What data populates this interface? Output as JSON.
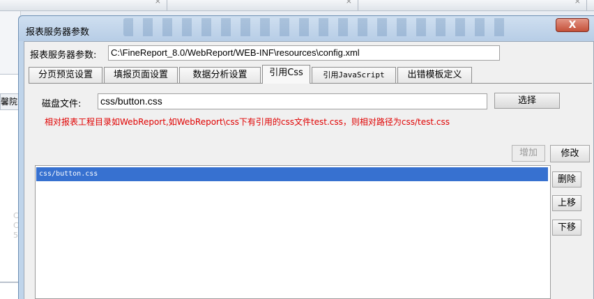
{
  "dialog": {
    "title": "报表服务器参数",
    "close_label": "X",
    "path_label": "报表服务器参数:",
    "path_value": "C:\\FineReport_8.0/WebReport/WEB-INF\\resources\\config.xml"
  },
  "tabs": [
    "分页预览设置",
    "填报页面设置",
    "数据分析设置",
    "引用Css",
    "引用JavaScript",
    "出错模板定义"
  ],
  "css_tab": {
    "disk_label": "磁盘文件:",
    "disk_value": "css/button.css",
    "choose_label": "选择",
    "hint": "相对报表工程目录如WebReport,如WebReport\\css下有引用的css文件test.css，则相对路径为css/test.css",
    "add_label": "增加",
    "modify_label": "修改",
    "delete_label": "删除",
    "up_label": "上移",
    "down_label": "下移",
    "list_items": [
      "css/button.css"
    ]
  },
  "background": {
    "left_label": "馨院",
    "faint_values": [
      "C",
      "C",
      "5"
    ]
  }
}
